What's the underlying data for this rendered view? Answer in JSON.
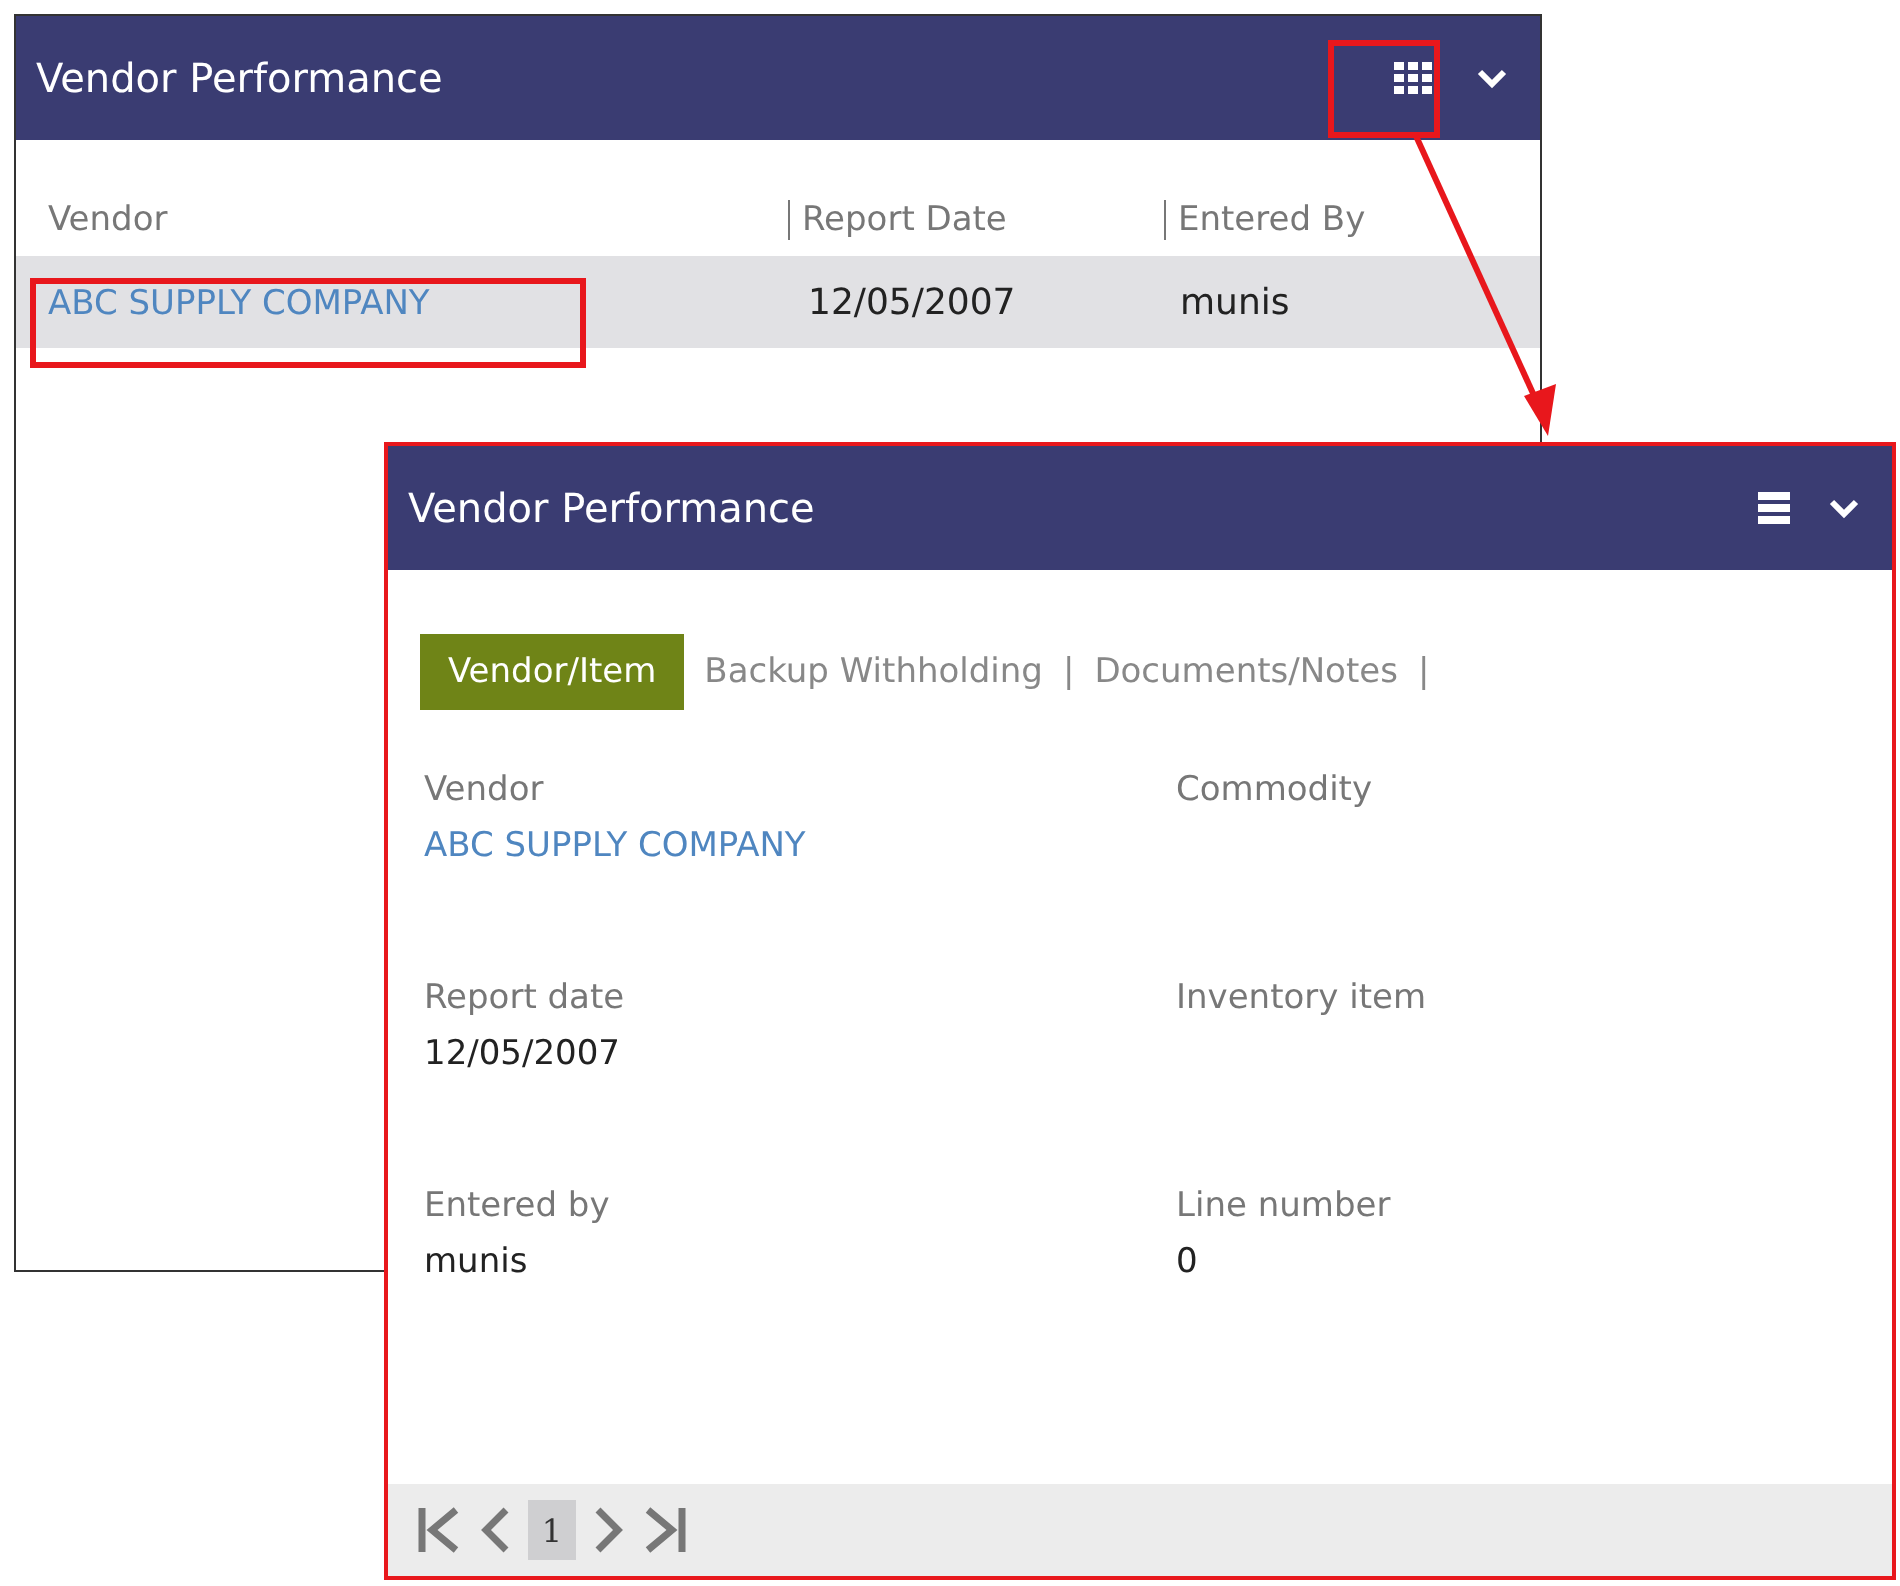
{
  "back_panel": {
    "title": "Vendor Performance",
    "columns": [
      "Vendor",
      "Report Date",
      "Entered By"
    ],
    "rows": [
      {
        "cells": [
          "ABC SUPPLY COMPANY",
          "12/05/2007",
          "munis"
        ],
        "selected": true
      }
    ]
  },
  "front_panel": {
    "title": "Vendor Performance",
    "tabs": [
      {
        "label": "Vendor/Item",
        "selected": true
      },
      {
        "label": "Backup Withholding",
        "selected": false,
        "separator": "|"
      },
      {
        "label": "Documents/Notes",
        "selected": false,
        "separator": "|"
      }
    ],
    "fields": [
      {
        "label": "Vendor",
        "value": "ABC SUPPLY COMPANY",
        "kind": "link"
      },
      {
        "label": "Commodity"
      },
      {
        "label": "Report date",
        "value": "12/05/2007",
        "kind": "text"
      },
      {
        "label": "Inventory item"
      },
      {
        "label": "Entered by",
        "value": "munis",
        "kind": "text"
      },
      {
        "label": "Line number",
        "value": "0",
        "kind": "text"
      }
    ],
    "pager": {
      "pages": [
        {
          "label": "1",
          "selected": true
        }
      ]
    }
  }
}
